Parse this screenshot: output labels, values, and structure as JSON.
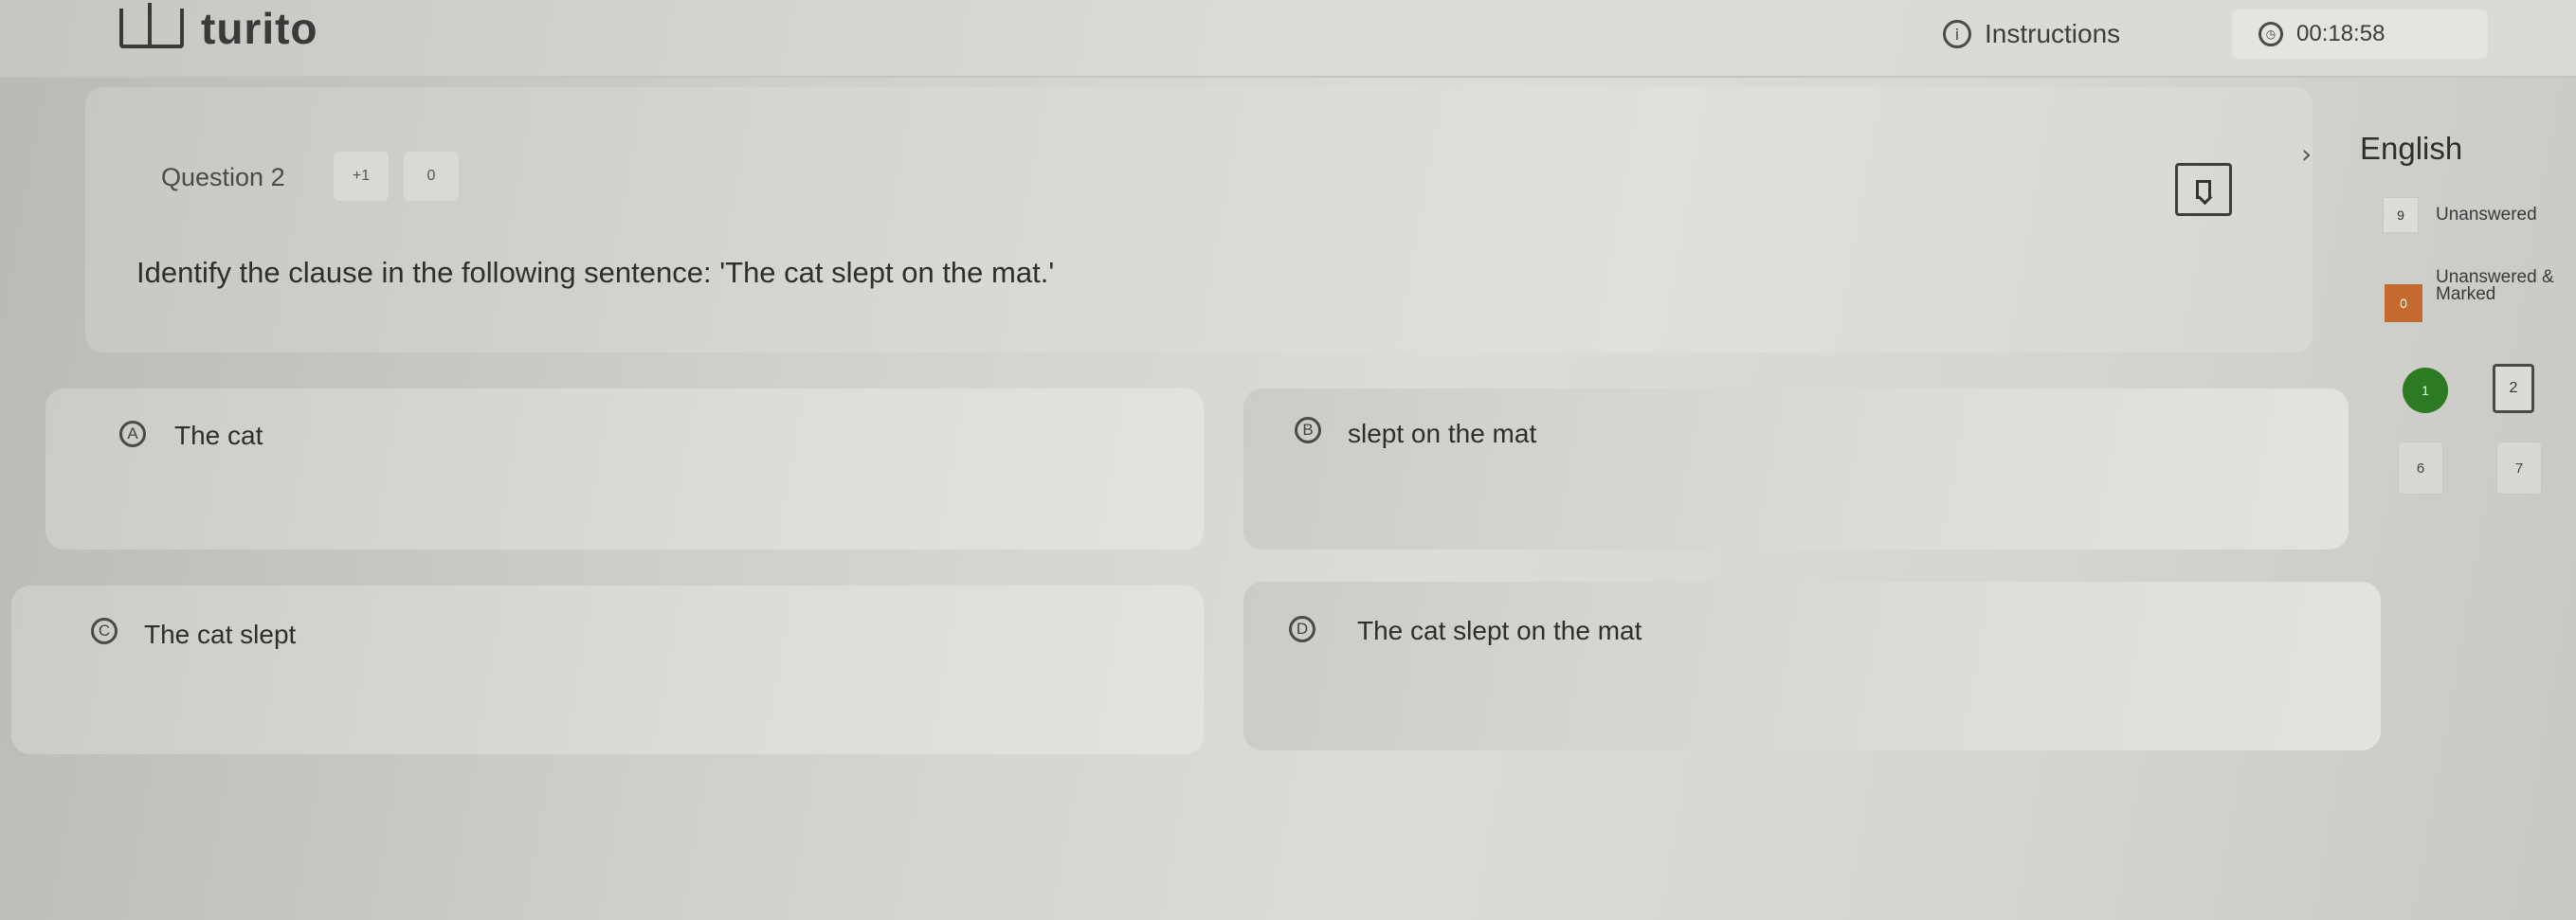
{
  "header": {
    "logo_text": "turito",
    "instructions_label": "Instructions",
    "timer": "00:18:58"
  },
  "question": {
    "label": "Question 2",
    "plus_marks": "+1",
    "minus_marks": "0",
    "text": "Identify the clause in the following sentence: 'The cat slept on the mat.'"
  },
  "options": [
    {
      "letter": "A",
      "text": "The cat"
    },
    {
      "letter": "B",
      "text": "slept on the mat"
    },
    {
      "letter": "C",
      "text": "The cat slept"
    },
    {
      "letter": "D",
      "text": "The cat slept on the mat"
    }
  ],
  "sidebar": {
    "language": "English",
    "unanswered_count": "9",
    "unanswered_label": "Unanswered",
    "marked_count": "0",
    "unanswered_marked_label": "Unanswered &",
    "marked_label": "Marked",
    "palette": [
      "1",
      "2",
      "6",
      "7"
    ]
  },
  "colors": {
    "answered": "#2c7a22",
    "marked": "#c46a2e"
  },
  "icons": {
    "instructions": "info-icon",
    "timer": "clock-icon",
    "bookmark": "bookmark-icon",
    "language": "chevron-right-icon"
  }
}
